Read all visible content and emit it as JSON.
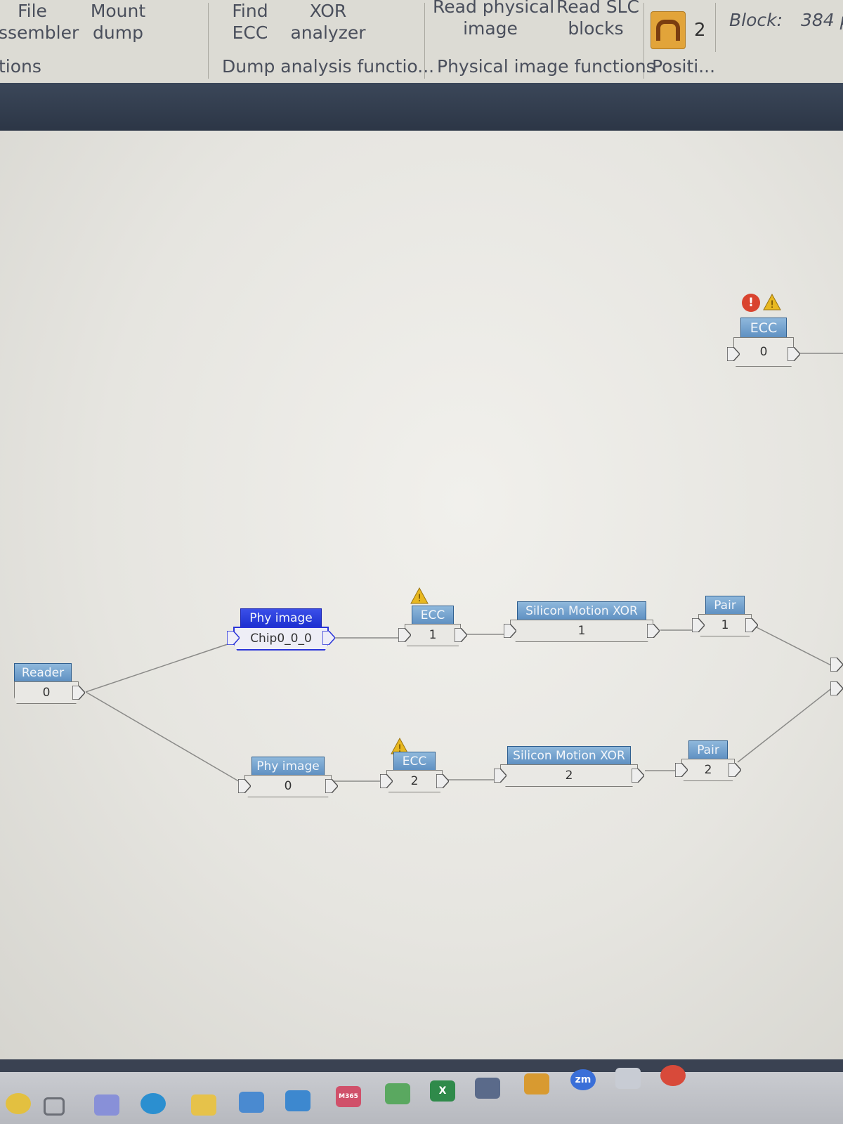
{
  "ribbon": {
    "buttons": [
      {
        "line1": "File",
        "line2": "ssembler"
      },
      {
        "line1": "Mount",
        "line2": "dump"
      },
      {
        "line1": "Find",
        "line2": "ECC"
      },
      {
        "line1": "XOR",
        "line2": "analyzer"
      },
      {
        "line1": "Read physical",
        "line2": "image"
      },
      {
        "line1": "Read SLC",
        "line2": "blocks"
      }
    ],
    "groups": [
      "tions",
      "Dump analysis functio...",
      "Physical image functions",
      "Positi..."
    ],
    "position_count": "2",
    "block_label": "Block:",
    "pages_value": "384 p"
  },
  "nodes": {
    "reader": {
      "title": "Reader",
      "value": "0"
    },
    "phy1": {
      "title": "Phy image",
      "value": "Chip0_0_0"
    },
    "phy2": {
      "title": "Phy image",
      "value": "0"
    },
    "ecc1": {
      "title": "ECC",
      "value": "1"
    },
    "ecc2": {
      "title": "ECC",
      "value": "2"
    },
    "ecc0": {
      "title": "ECC",
      "value": "0"
    },
    "xor1": {
      "title": "Silicon Motion XOR",
      "value": "1"
    },
    "xor2": {
      "title": "Silicon Motion XOR",
      "value": "2"
    },
    "pair1": {
      "title": "Pair",
      "value": "1"
    },
    "pair2": {
      "title": "Pair",
      "value": "2"
    }
  },
  "badges": {
    "error_symbol": "!"
  },
  "taskbar": {
    "icons": [
      "start-icon",
      "task-view-icon",
      "teams-icon",
      "edge-icon",
      "file-explorer-icon",
      "store-icon",
      "outlook-icon",
      "m365-icon",
      "onedrive-icon",
      "excel-icon",
      "snipping-tool-icon",
      "paint-icon",
      "zoom-icon",
      "cloud-app-icon",
      "chrome-icon"
    ],
    "m365_label": "M365",
    "excel_label": "X",
    "zoom_label": "zm"
  },
  "colors": {
    "node_header": "#5d8fc1",
    "selected_header": "#1c2fd0",
    "warning": "#e8b820",
    "error": "#d9442f",
    "band": "#2c3646"
  }
}
